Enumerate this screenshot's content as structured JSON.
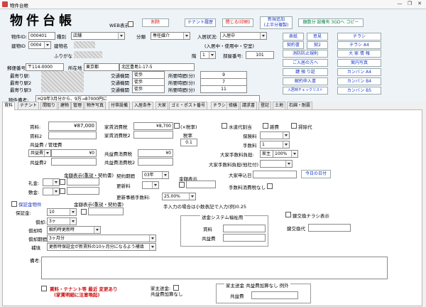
{
  "window": {
    "title": "物件台帳",
    "minimize": "—",
    "restore": "❐",
    "close": "✕"
  },
  "header": {
    "big_title": "物件台帳",
    "web_label": "WEB表示",
    "delete_btn": "削除",
    "tenant_history_btn": "テナント履歴",
    "close_btn": "閉じる(印刷)",
    "new_add_btn": "新規追加\n(上半分複製)",
    "copy_btn": "額数分 設備有 3GDへ コピー",
    "property_id_label": "物件ID:",
    "property_id": "000401",
    "type_label": "種別",
    "type": "店舗",
    "category_label": "分類",
    "category": "専任媒介",
    "building_id_label": "建物ID",
    "building_id": "0004",
    "building_name_label": "建物名",
    "furigana_label": "ふりがな",
    "status_label": "入居状況:",
    "status": "入居中",
    "status_note": "(入居中・使用中・空室)",
    "floor_label": "階",
    "floor": "1",
    "room_label": "部屋番号:",
    "room": "101",
    "zip_label": "郵便番号:",
    "zip": "〒114-0000",
    "address_label": "所在地",
    "address_pref": "東京都",
    "address_city": "北区豊島1-17-5",
    "stations": [
      {
        "label": "最寄り駅:",
        "transit_label": "交通機関",
        "transit": "徒歩",
        "time_label": "所要時間(分)",
        "time": "9"
      },
      {
        "label": "最寄り駅2",
        "transit_label": "交通機関",
        "transit": "徒歩",
        "time_label": "所要時間(分)",
        "time": "7"
      },
      {
        "label": "最寄り駅3",
        "transit_label": "交通機関",
        "transit": "徒歩",
        "time_label": "所要時間(分)",
        "time": "11"
      }
    ],
    "remarks_label": "物件備考:",
    "remarks": "H29年3月分から、9万→87000円に",
    "side_buttons": {
      "figure": "表紙",
      "opinion": "意見",
      "chirashi": "チラシ",
      "contract": "契約書",
      "contract2": "契2",
      "chirashi_a4": "チラシ A4",
      "fire": "消防防止規則",
      "big_info": "大 家 情 報",
      "move_in": "ご入居の方へ",
      "room_guide": "案内写真",
      "key_return": "鍵 預 り証",
      "kanban_a4": "カンバン A4",
      "cancel_app": "解約申入書",
      "kanban_b4": "カンバン B4",
      "checklist": "入居時チェックリスト",
      "kanban_b5": "カンバン B5"
    }
  },
  "tabs": [
    "賃料",
    "テナント",
    "間取り",
    "建物",
    "管理",
    "物件写真",
    "付帯設備",
    "入居条件",
    "大家",
    "ゴミ・ポスト番号",
    "チラシ",
    "修繕",
    "請求書",
    "登記",
    "土地",
    "石綿・耐震"
  ],
  "rent": {
    "rent_label": "賃料:",
    "rent": "¥87,000",
    "rent2_label": "賃料2",
    "common_label": "共益費 / 管理費",
    "common_type": "共益費",
    "common_amount": "¥0",
    "common2_label": "共益費2",
    "tax_label": "家賃消費税",
    "tax": "¥8,700",
    "tax2_label": "家賃消費税2",
    "ex_tax_label": "(×税率)",
    "tax_rate_label": "税率",
    "tax_rate": "0.1",
    "common_tax_label": "共益費消費税",
    "common_tax": "¥0",
    "common_tax2_label": "共益費消費税2",
    "water_label": "水道代割当",
    "misc_label": "雑費",
    "parking_label": "掃除代",
    "guarantee_label": "保険料",
    "fee_label": "手数料",
    "fee": "1",
    "landlord_fee_label": "大家手数料負担:",
    "landlord_fee_who": "家主",
    "landlord_fee_pct": "100%",
    "landlord_fee_other_label": "大家手数料負担(他社付)",
    "landlord_date_label": "大家申込日",
    "today_btn": "今日の日付",
    "fee_tax_none_label": "手数料消費税なし",
    "amount_display_label": "金額表示(重説・契約書)",
    "key_money_label": "礼金:",
    "deposit_label": "敷金:",
    "contract_period_label": "契約期間",
    "contract_period": "03年",
    "renewal_label": "更新料",
    "amount_display2_label": "金額表示",
    "renewal_fee_label": "更新事務手数料:",
    "renewal_fee": "25.00%",
    "rounding_note": "手入力の場合は小数表記で入力(例)0.25",
    "guarantor_label": "保証金物件",
    "guarantor_deposit_label": "保証金:",
    "guarantor_deposit": "10",
    "amount_display3_label": "金額表示(重説・契約書)",
    "amortize_label": "償却:",
    "amortize_unit": "3ヶ",
    "amortize_time_label": "償却時",
    "amortize_time": "解約時更新時",
    "amortize_period_label": "償却期間",
    "amortize_period": "3ヶ月分",
    "supplement_label": "補填",
    "supplement": "更新時保証金が新賃料の10ヶ月分になるよう補填",
    "system_box_label": "送金システム福祉用",
    "system_rent_label": "賃料",
    "system_common_label": "共益費",
    "key_change_label": "鍵交換チラシ表示",
    "key_change_fee_label": "鍵交換代",
    "notes_label": "備考:",
    "warn_line1": "賃料・テナント等 最近 変更あり",
    "warn_line2": "(家賃明細に注意喚起)",
    "owner_send_label1": "家主送金:",
    "owner_send_label2": "共益費加算なし",
    "owner_box_title": "家主送金 共益費加算なし 例外",
    "owner_common_label": "共益費"
  }
}
